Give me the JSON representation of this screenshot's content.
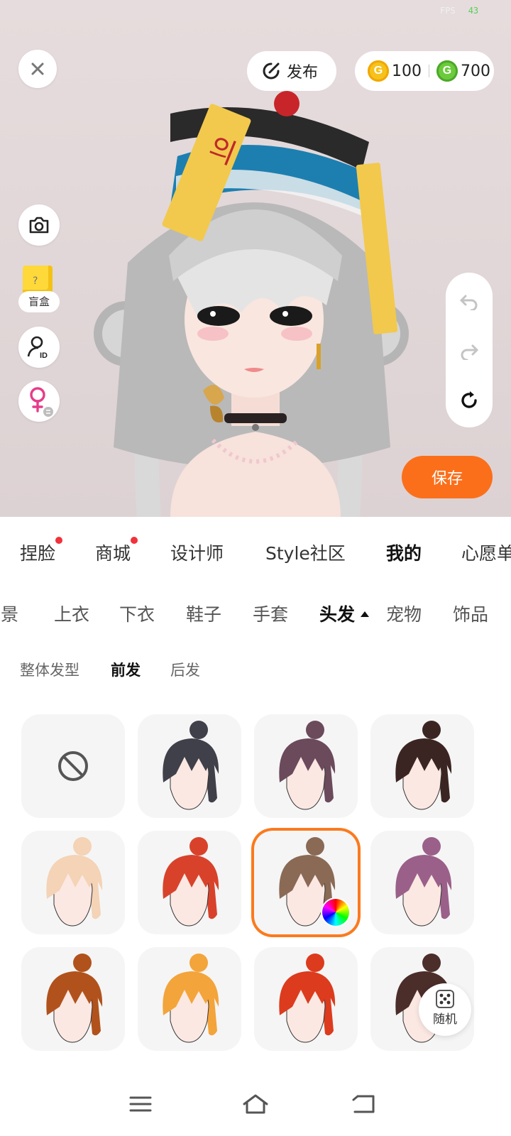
{
  "status": {
    "fps_label": "FPS",
    "fps_value": "43"
  },
  "top": {
    "publish_label": "发布",
    "currency": [
      {
        "icon": "gold-coin-icon",
        "value": "100"
      },
      {
        "icon": "green-coin-icon",
        "value": "700"
      }
    ]
  },
  "side_tools": {
    "blindbox_label": "盲盒"
  },
  "save_label": "保存",
  "main_tabs": [
    {
      "label": "捏脸",
      "dot": true
    },
    {
      "label": "商城",
      "dot": true
    },
    {
      "label": "设计师",
      "dot": false
    },
    {
      "label": "Style社区",
      "dot": false
    },
    {
      "label": "我的",
      "dot": false,
      "active": true
    },
    {
      "label": "心愿单",
      "dot": false
    }
  ],
  "sub_tabs": [
    {
      "label": "背景"
    },
    {
      "label": "上衣"
    },
    {
      "label": "下衣"
    },
    {
      "label": "鞋子"
    },
    {
      "label": "手套"
    },
    {
      "label": "头发",
      "active": true
    },
    {
      "label": "宠物"
    },
    {
      "label": "饰品"
    }
  ],
  "hair_types": [
    {
      "label": "整体发型"
    },
    {
      "label": "前发",
      "active": true
    },
    {
      "label": "后发"
    }
  ],
  "hair_items": [
    {
      "kind": "none"
    },
    {
      "color": "#3f4049"
    },
    {
      "color": "#6b4a5c"
    },
    {
      "color": "#3b2522"
    },
    {
      "color": "#f4d3b6"
    },
    {
      "color": "#d8422b"
    },
    {
      "color": "#8a6a55",
      "selected": true
    },
    {
      "color": "#9a6089"
    },
    {
      "color": "#b1521c"
    },
    {
      "color": "#f3a43a"
    },
    {
      "color": "#dc3b1d"
    },
    {
      "color": "#4b2d2a"
    }
  ],
  "random_label": "随机",
  "colors": {
    "accent": "#fb6f1b",
    "red_dot": "#f2313b"
  }
}
